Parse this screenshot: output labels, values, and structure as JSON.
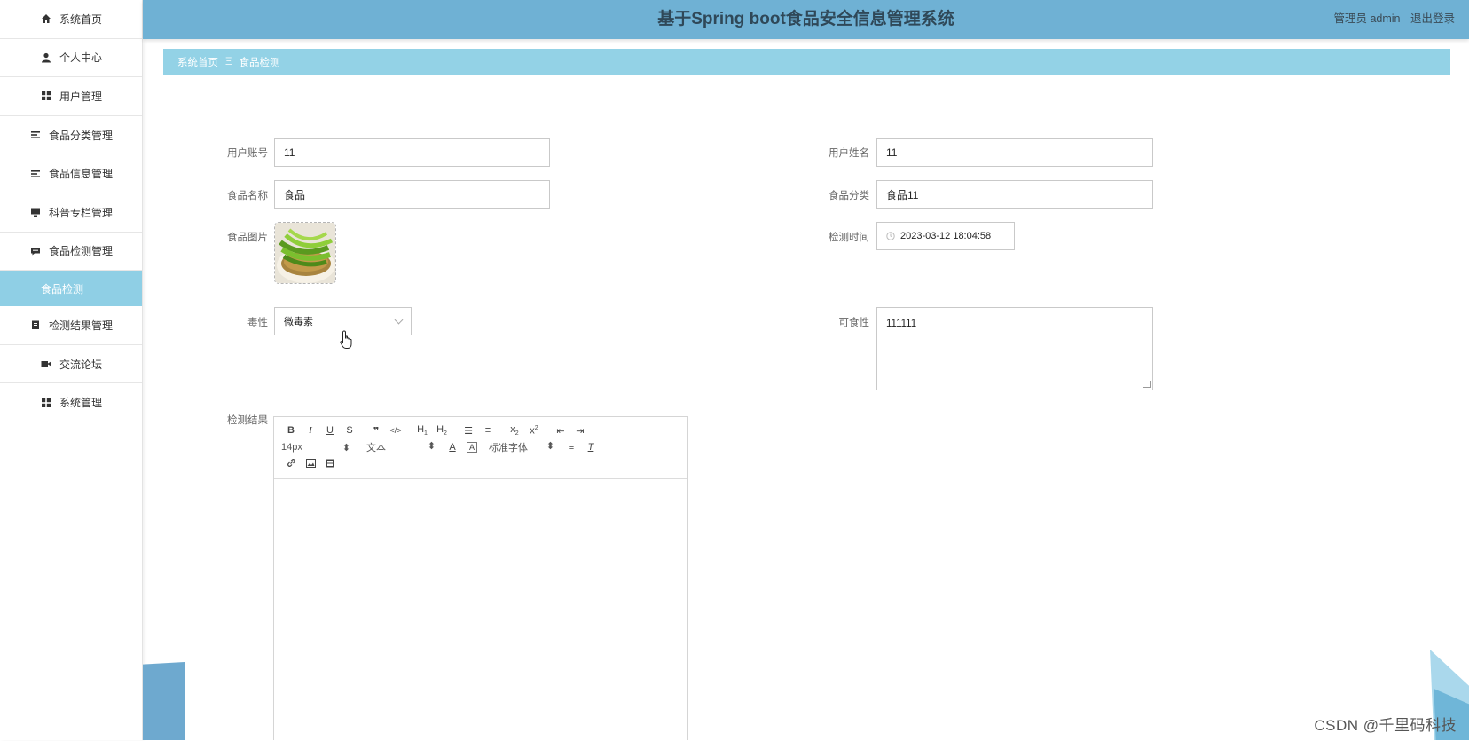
{
  "app": {
    "title": "基于Spring boot食品安全信息管理系统",
    "user_label": "管理员 admin",
    "logout_label": "退出登录"
  },
  "sidebar": {
    "items": [
      {
        "label": "系统首页",
        "icon": "home-icon"
      },
      {
        "label": "个人中心",
        "icon": "person-icon"
      },
      {
        "label": "用户管理",
        "icon": "grid-icon"
      },
      {
        "label": "食品分类管理",
        "icon": "list-icon"
      },
      {
        "label": "食品信息管理",
        "icon": "list-icon"
      },
      {
        "label": "科普专栏管理",
        "icon": "monitor-icon"
      },
      {
        "label": "食品检测管理",
        "icon": "chat-icon"
      }
    ],
    "active_sub": "食品检测",
    "items_after": [
      {
        "label": "检测结果管理",
        "icon": "clipboard-icon"
      },
      {
        "label": "交流论坛",
        "icon": "video-icon"
      },
      {
        "label": "系统管理",
        "icon": "grid-icon"
      }
    ]
  },
  "breadcrumb": {
    "home": "系统首页",
    "separator": "Ξ",
    "current": "食品检测"
  },
  "form": {
    "account_label": "用户账号",
    "account_value": "11",
    "username_label": "用户姓名",
    "username_value": "11",
    "food_name_label": "食品名称",
    "food_name_value": "食品",
    "category_label": "食品分类",
    "category_value": "食品11",
    "image_label": "食品图片",
    "time_label": "检测时间",
    "time_value": "2023-03-12 18:04:58",
    "toxicity_label": "毒性",
    "toxicity_value": "微毒素",
    "edible_label": "可食性",
    "edible_value": "111111",
    "result_label": "检测结果"
  },
  "editor": {
    "font_size": "14px",
    "header_select": "文本",
    "font_family": "标准字体"
  },
  "colors": {
    "header": "#6fb1d4",
    "breadcrumb": "#93d2e6",
    "active_menu": "#8fcfe5"
  },
  "watermark": "CSDN @千里码科技"
}
